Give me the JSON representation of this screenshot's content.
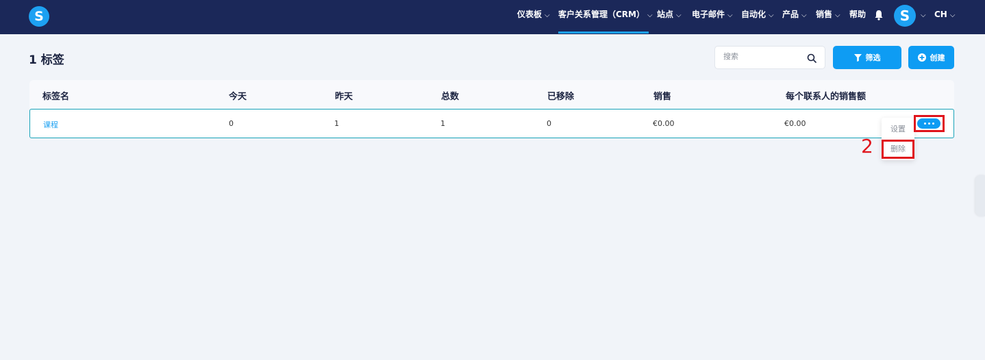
{
  "brand": {
    "logo_letter": "S"
  },
  "nav": {
    "items": [
      {
        "label": "仪表板",
        "has_dropdown": true
      },
      {
        "label": "客户关系管理（CRM）",
        "has_dropdown": true,
        "active": true
      },
      {
        "label": "站点",
        "has_dropdown": true
      },
      {
        "label": "电子邮件",
        "has_dropdown": true
      },
      {
        "label": "自动化",
        "has_dropdown": true
      },
      {
        "label": "产品",
        "has_dropdown": true
      },
      {
        "label": "销售",
        "has_dropdown": true
      },
      {
        "label": "帮助",
        "has_dropdown": false
      }
    ],
    "chevron": "⌵",
    "avatar_letter": "S",
    "language": "CH"
  },
  "page": {
    "title": "1 标签",
    "search_placeholder": "搜索",
    "filter_label": "筛选",
    "create_label": "创建"
  },
  "table": {
    "columns": [
      "标签名",
      "今天",
      "昨天",
      "总数",
      "已移除",
      "销售",
      "每个联系人的销售额"
    ],
    "rows": [
      {
        "name": "课程",
        "today": "0",
        "yesterday": "1",
        "total": "1",
        "removed": "0",
        "sales": "€0.00",
        "sales_per_contact": "€0.00"
      }
    ]
  },
  "dropdown_menu": {
    "items": [
      "设置",
      "删除"
    ]
  },
  "annotation": {
    "step_number": "2",
    "highlight_color": "#e0141c"
  },
  "colors": {
    "nav_bg": "#1b2859",
    "accent": "#0e9cf3",
    "link": "#1da1f2",
    "row_border": "#17a2b8"
  }
}
